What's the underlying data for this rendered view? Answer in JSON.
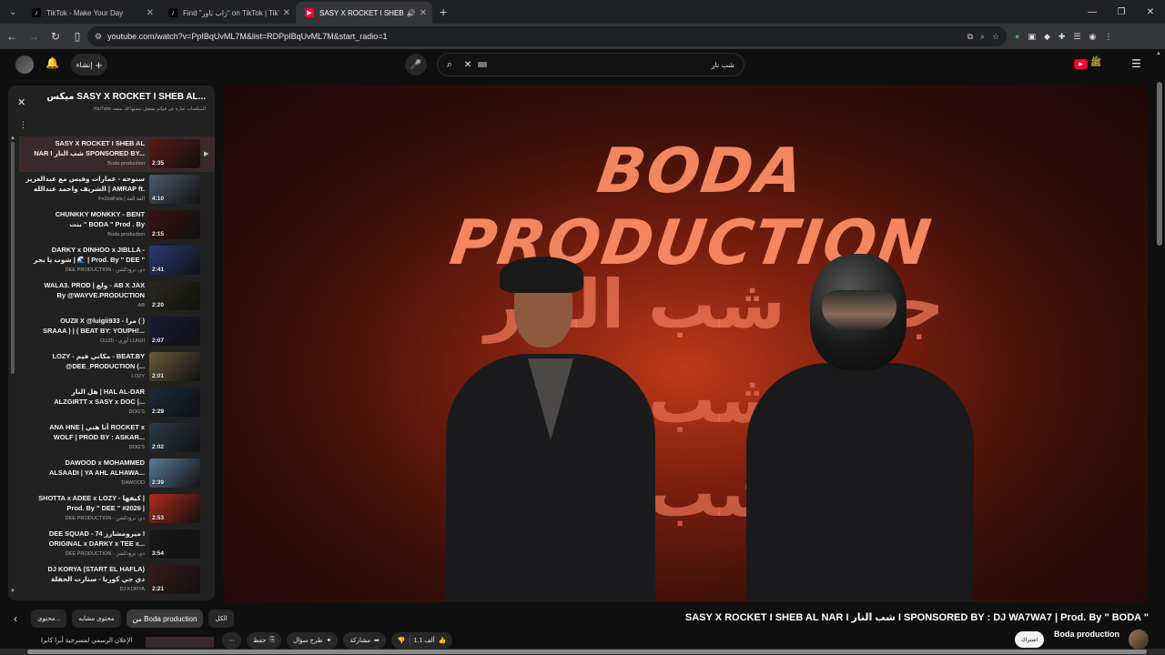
{
  "browser": {
    "tabs": [
      {
        "title": "TikTok - Make Your Day",
        "active": false
      },
      {
        "title": "Find \"رَاب بَاوِر\" on TikTok | TikTok",
        "active": false
      },
      {
        "title": "SASY X ROCKET I SHEB AL NAR",
        "active": true
      }
    ],
    "url": "youtube.com/watch?v=PpIBqUvML7M&list=RDPpIBqUvML7M&start_radio=1"
  },
  "header": {
    "create_label": "إنشاء",
    "search_query": "شب نار"
  },
  "playlist": {
    "title": "ميكس SASY X ROCKET I SHEB AL...",
    "subtitle": "الميكسات عبارة عن قوائم تشغيل تنشئها لك منصة YouTube.",
    "items": [
      {
        "l1": "SASY X ROCKET I SHEB AL",
        "l2": "NAR I شب النار SPONSORED BY...",
        "channel": "Boda production",
        "duration": "2:35",
        "color": "#5a1a12",
        "active": true
      },
      {
        "l1": "سنوحه - عمارات وفيس مع عبدالعزيز",
        "l2": "الشريف واحمد عبدالله | AMRAP ft.",
        "channel": "Fe2saFala | الفة الفة",
        "duration": "4:10",
        "color": "#4a5a70"
      },
      {
        "l1": "CHUNKKY MONKKY - BENT",
        "l2": "بنت \" BODA \" Prod . By",
        "channel": "Boda production",
        "duration": "2:15",
        "color": "#3a1212"
      },
      {
        "l1": "DARKY x DINHOO x JIBLLA -",
        "l2": "شوب يا بحر | 🌊 | Prod. By \" DEE \"",
        "channel": "DEE PRODUCTION - دي. برودكشن",
        "duration": "2:41",
        "color": "#2a3a7a"
      },
      {
        "l1": "WALA3. PROD | ولع - AB X JAX",
        "l2": "By @WAYVE.PRODUCTION",
        "channel": "AB",
        "duration": "2:20",
        "color": "#2a2a1a"
      },
      {
        "l1": "OUZII X @luigii933 - مرا ( )",
        "l2": "SRAAA ) | ( BEAT BY: YOUPH!...",
        "channel": "OUZII - أوزي LUIGII",
        "duration": "2:07",
        "color": "#1a1a3a"
      },
      {
        "l1": "LOZY - مكاني فيم - BEAT.BY",
        "l2": "@DEE_PRODUCTION (...",
        "channel": "LOZY",
        "duration": "2:01",
        "color": "#6a5a3a"
      },
      {
        "l1": "هل النار | HAL AL-DAR",
        "l2": "ALZGIRTT x SASY x DOC |...",
        "channel": "DOG'S",
        "duration": "2:29",
        "color": "#1a2a3a"
      },
      {
        "l1": "ANA HNE | أنا هني ROCKET x",
        "l2": "WOLF | PROD BY : ASKAR...",
        "channel": "DOG'S",
        "duration": "2:02",
        "color": "#2a3a4a"
      },
      {
        "l1": "DAWOOD x MOHAMMED",
        "l2": "ALSAADI | YA AHL ALHAWA...",
        "channel": "DAWOOD",
        "duration": "2:39",
        "color": "#5a7a9a"
      },
      {
        "l1": "SHOTTA x ADEE x LOZY - كيفها |",
        "l2": "Prod. By \" DEE \" #2026 |",
        "channel": "DEE PRODUCTION - دي. برودكشن",
        "duration": "2:53",
        "color": "#b02a1a"
      },
      {
        "l1": "DEE SQUAD - ميرومشارز 74 I",
        "l2": "ORIGINAL x DARKY x TEE x...",
        "channel": "DEE PRODUCTION - دي. برودكشن",
        "duration": "3:54",
        "color": "#1a1a1a"
      },
      {
        "l1": "DJ KORYA (START EL HAFLA)",
        "l2": "دي جي كوريا - ستارت الحفلة",
        "channel": "DJ KORYA",
        "duration": "2:21",
        "color": "#3a1a1a"
      }
    ]
  },
  "video": {
    "brand_text": "BODA PRODUCTION",
    "arabic_lines": [
      "جاي شب النار",
      "جاي شب النار",
      "جاي شب النار"
    ],
    "title": "SASY X ROCKET I SHEB AL NAR I شب النار I SPONSORED BY : DJ WA7WA7 | Prod. By \" BODA \"",
    "channel": "Boda production",
    "subscribe_label": "اشتراك",
    "likes": "1.1 ألف",
    "actions": {
      "share": "مشاركة",
      "ask": "طرح سؤال",
      "save": "حفظ"
    }
  },
  "chips": {
    "all": "الكل",
    "from_channel": "من Boda production",
    "related": "محتوى مشابه",
    "more": "محتوى..."
  },
  "bottom_row": {
    "text": "الإعلان الرسمي لمسرحية أبرا كابرا"
  },
  "colors": {
    "yt_red": "#ff0033",
    "accent_orange": "#f3865f"
  }
}
